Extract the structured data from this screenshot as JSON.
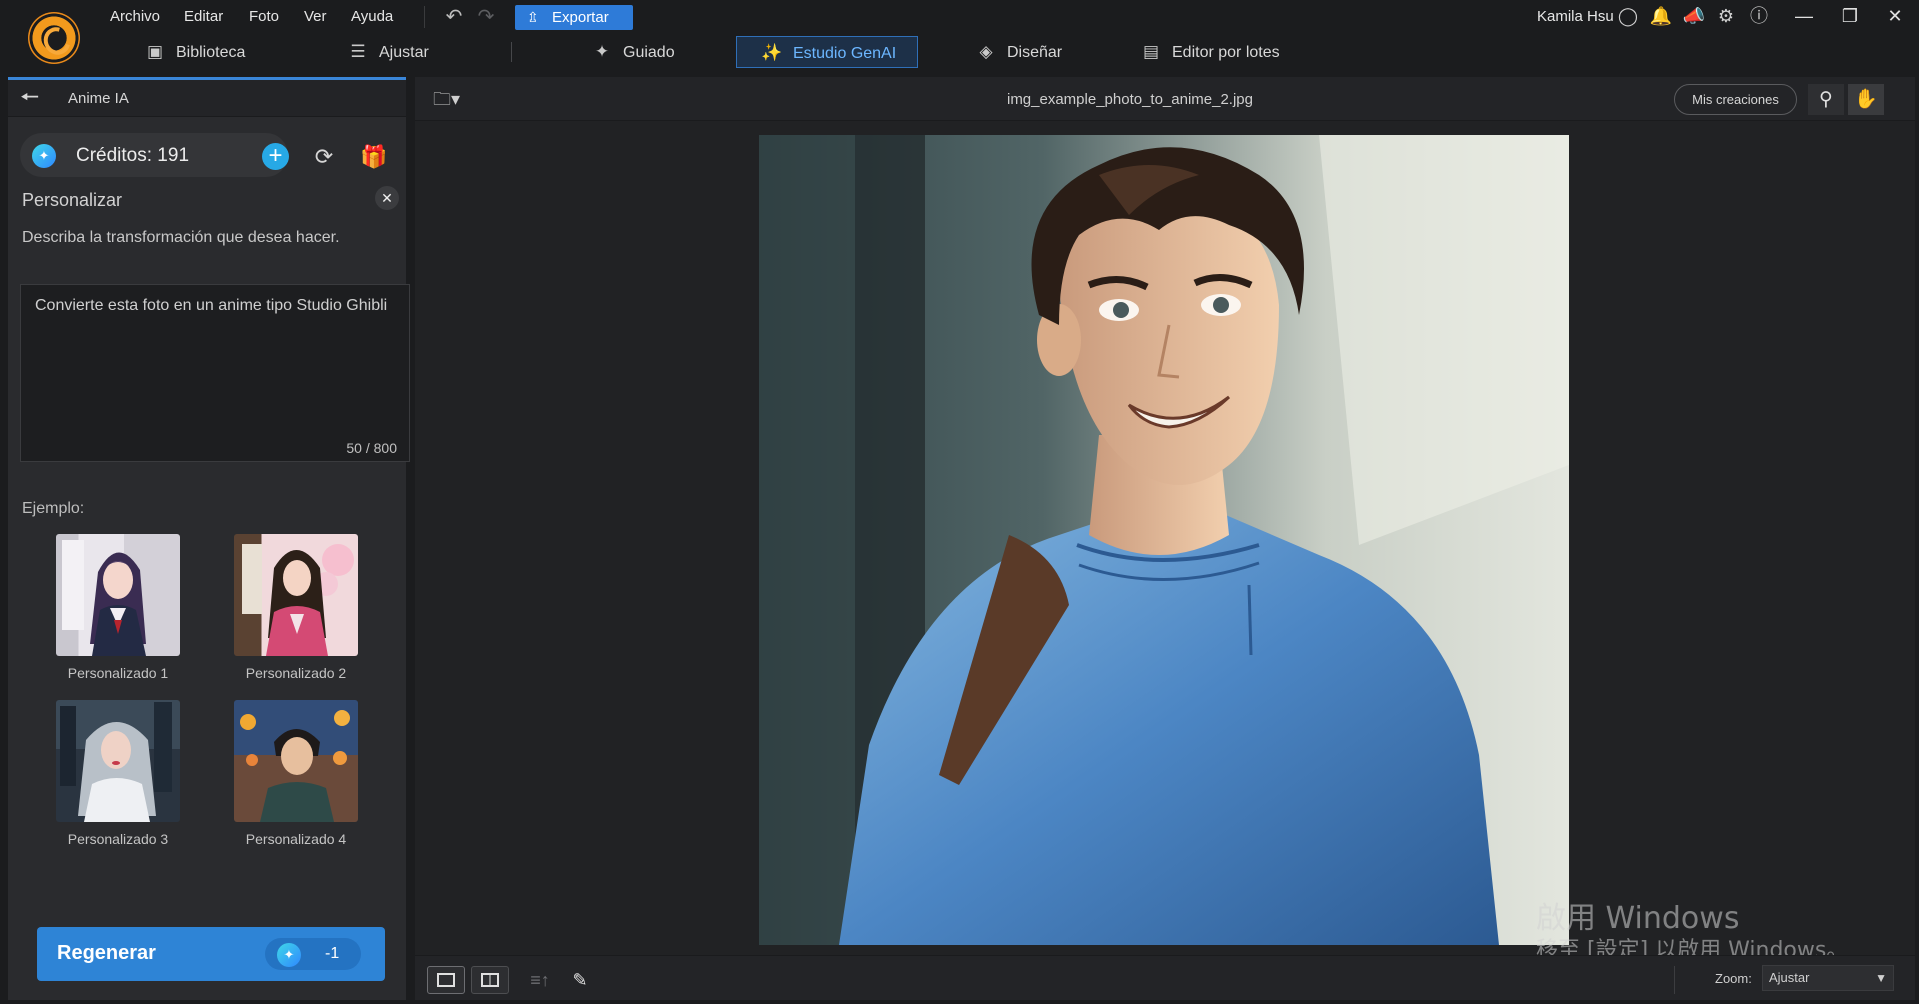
{
  "menu": {
    "items": [
      "Archivo",
      "Editar",
      "Foto",
      "Ver",
      "Ayuda"
    ],
    "export_label": "Exportar"
  },
  "account": {
    "user_name": "Kamila Hsu"
  },
  "modes": {
    "tabs": [
      {
        "label": "Biblioteca",
        "icon": "library-icon"
      },
      {
        "label": "Ajustar",
        "icon": "sliders-icon"
      },
      {
        "label": "Guiado",
        "icon": "magic-wand-icon"
      },
      {
        "label": "Estudio GenAI",
        "icon": "sparkles-icon",
        "active": true
      },
      {
        "label": "Diseñar",
        "icon": "layers-icon"
      },
      {
        "label": "Editor por lotes",
        "icon": "batch-images-icon"
      }
    ]
  },
  "panel": {
    "title": "Anime IA",
    "credits_label": "Créditos: 191",
    "custom_title": "Personalizar",
    "custom_desc": "Describa la transformación que desea hacer.",
    "prompt_text": "Convierte esta foto en un anime tipo Studio Ghibli",
    "char_count": "50 / 800",
    "examples_label": "Ejemplo:",
    "examples": [
      {
        "label": "Personalizado 1"
      },
      {
        "label": "Personalizado 2"
      },
      {
        "label": "Personalizado 3"
      },
      {
        "label": "Personalizado 4"
      }
    ],
    "regen_label": "Regenerar",
    "regen_cost": "-1"
  },
  "viewer": {
    "file_name": "img_example_photo_to_anime_2.jpg",
    "my_creations": "Mis creaciones",
    "zoom_label": "Zoom:",
    "zoom_value": "Ajustar"
  },
  "watermark": {
    "line1": "啟用 Windows",
    "line2": "移至 [設定] 以啟用 Windows。"
  },
  "colors": {
    "accent": "#2e84d6",
    "active_tab_text": "#6cb6ff",
    "background": "#1b1c1e"
  }
}
